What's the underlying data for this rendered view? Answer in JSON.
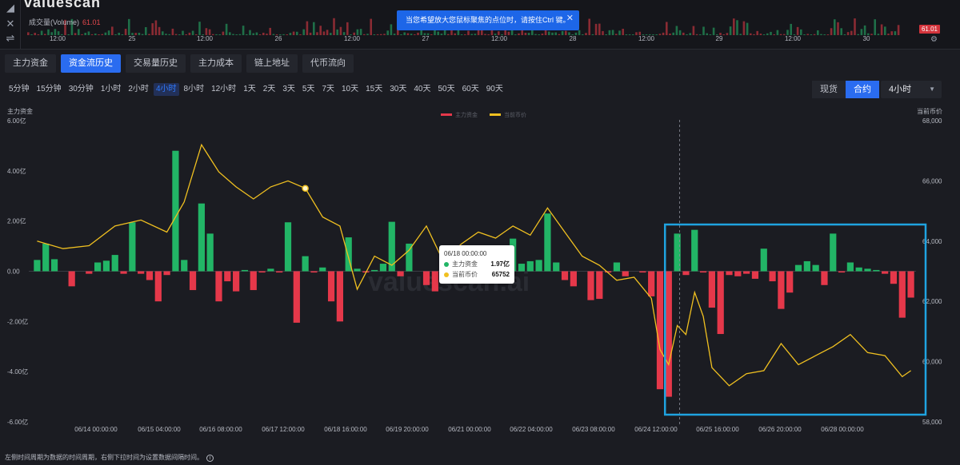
{
  "colors": {
    "positive": "#22b566",
    "negative": "#e5384a",
    "price_line": "#f0c020",
    "accent": "#2a6cf0",
    "highlight_box": "#1fa3e0"
  },
  "top": {
    "logo_fragment": "valuescan",
    "volume_label": "成交量(Volume)",
    "volume_value": "61.01",
    "price_badge": "61.01",
    "toast_text": "当您希望放大您鼠标聚焦的点位时，请按住Ctrl 键。",
    "toast_close_icon": "close-icon",
    "time_ticks": [
      "12:00",
      "25",
      "12:00",
      "26",
      "12:00",
      "27",
      "12:00",
      "28",
      "12:00",
      "29",
      "12:00",
      "30"
    ]
  },
  "tabs": [
    {
      "label": "主力资金",
      "active": false
    },
    {
      "label": "资金流历史",
      "active": true
    },
    {
      "label": "交易量历史",
      "active": false
    },
    {
      "label": "主力成本",
      "active": false
    },
    {
      "label": "链上地址",
      "active": false
    },
    {
      "label": "代币流向",
      "active": false
    }
  ],
  "periods": [
    {
      "label": "5分钟",
      "active": false
    },
    {
      "label": "15分钟",
      "active": false
    },
    {
      "label": "30分钟",
      "active": false
    },
    {
      "label": "1小时",
      "active": false
    },
    {
      "label": "2小时",
      "active": false
    },
    {
      "label": "4小时",
      "active": true
    },
    {
      "label": "8小时",
      "active": false
    },
    {
      "label": "12小时",
      "active": false
    },
    {
      "label": "1天",
      "active": false
    },
    {
      "label": "2天",
      "active": false
    },
    {
      "label": "3天",
      "active": false
    },
    {
      "label": "5天",
      "active": false
    },
    {
      "label": "7天",
      "active": false
    },
    {
      "label": "10天",
      "active": false
    },
    {
      "label": "15天",
      "active": false
    },
    {
      "label": "30天",
      "active": false
    },
    {
      "label": "40天",
      "active": false
    },
    {
      "label": "50天",
      "active": false
    },
    {
      "label": "60天",
      "active": false
    },
    {
      "label": "90天",
      "active": false
    }
  ],
  "market": {
    "spot_label": "现货",
    "contract_label": "合约",
    "interval_value": "4小时"
  },
  "tooltip": {
    "time": "06/18 00:00:00",
    "rows": [
      {
        "name": "主力资金",
        "value": "1.97亿",
        "color": "#22b566"
      },
      {
        "name": "当前币价",
        "value": "65752",
        "color": "#f0c020"
      }
    ]
  },
  "footer": {
    "note": "左侧时间周期为数据的时间周期，右侧下拉时间为设置数据间隔时间。"
  },
  "chart_data": {
    "type": "bar",
    "left_axis_title": "主力资金",
    "right_axis_title": "当前币价",
    "legend": [
      "主力资金",
      "当前币价"
    ],
    "left_ylim": [
      -6,
      6
    ],
    "left_ticks": [
      "6.00亿",
      "4.00亿",
      "2.00亿",
      "0.00",
      "-2.00亿",
      "-4.00亿",
      "-6.00亿"
    ],
    "right_ylim": [
      58000,
      68000
    ],
    "right_ticks": [
      "68,000",
      "66,000",
      "64,000",
      "62,000",
      "60,000",
      "58,000"
    ],
    "x_ticks": [
      "06/14 00:00:00",
      "06/15 04:00:00",
      "06/16 08:00:00",
      "06/17 12:00:00",
      "06/18 16:00:00",
      "06/19 20:00:00",
      "06/21 00:00:00",
      "06/22 04:00:00",
      "06/23 08:00:00",
      "06/24 12:00:00",
      "06/25 16:00:00",
      "06/26 20:00:00",
      "06/28 00:00:00"
    ],
    "series": [
      {
        "name": "主力资金",
        "unit": "亿",
        "values": [
          0.45,
          1.1,
          0.48,
          0,
          -0.6,
          0,
          -0.1,
          0.35,
          0.42,
          0.65,
          -0.1,
          1.95,
          -0.1,
          -0.35,
          -1.2,
          -0.15,
          4.8,
          0.45,
          -0.75,
          2.7,
          1.5,
          -1.2,
          -0.4,
          -0.8,
          0.05,
          -0.75,
          -0.05,
          0.1,
          -0.05,
          1.95,
          -2.05,
          0.6,
          -0.05,
          0.15,
          -1.2,
          -2.0,
          1.35,
          0.1,
          -0.05,
          0.05,
          0.3,
          1.97,
          -0.2,
          1.1,
          0,
          -0.55,
          -0.8,
          -0.05,
          0.45,
          0,
          0.3,
          0.35,
          0.55,
          0.2,
          0,
          1.3,
          0.3,
          0.4,
          0.45,
          2.3,
          0.35,
          -0.35,
          -0.6,
          0,
          -1.15,
          -1.1,
          -0.05,
          0.35,
          -0.2,
          0,
          -0.05,
          -1.0,
          -4.7,
          -5.0,
          1.5,
          -0.15,
          1.65,
          -0.05,
          -1.45,
          -2.5,
          -0.15,
          -0.2,
          -0.1,
          -0.3,
          0.9,
          -0.4,
          -1.5,
          -0.85,
          0.25,
          0.4,
          0.25,
          -0.55,
          1.5,
          -0.05,
          0.35,
          0.15,
          0.1,
          0.05,
          -0.1,
          -0.5,
          -1.85,
          -1.05
        ]
      },
      {
        "name": "当前币价",
        "x_index": [
          0,
          3,
          6,
          9,
          12,
          15,
          17,
          19,
          21,
          23,
          25,
          27,
          29,
          31,
          33,
          35,
          37,
          39,
          41,
          43,
          45,
          47,
          49,
          51,
          53,
          55,
          57,
          59,
          61,
          63,
          65,
          67,
          69,
          71,
          72,
          73,
          74,
          75,
          76,
          77,
          78,
          80,
          82,
          84,
          86,
          88,
          90,
          92,
          94,
          96,
          98,
          100,
          101
        ],
        "values": [
          64000,
          63750,
          63850,
          64500,
          64700,
          64300,
          65300,
          67200,
          66300,
          65800,
          65400,
          65800,
          66000,
          65752,
          64800,
          64500,
          62400,
          63500,
          63200,
          63700,
          64500,
          63300,
          63900,
          64300,
          64100,
          64500,
          64200,
          65100,
          64300,
          63500,
          63200,
          62700,
          62800,
          62100,
          60400,
          59900,
          61200,
          60900,
          62300,
          61500,
          59800,
          59200,
          59600,
          59700,
          60600,
          59900,
          60200,
          60500,
          60900,
          60300,
          60200,
          59500,
          59700
        ]
      }
    ],
    "highlight": {
      "start_index": 74,
      "end_index": 104
    },
    "crosshair_index": 74,
    "marker_index": 31
  }
}
